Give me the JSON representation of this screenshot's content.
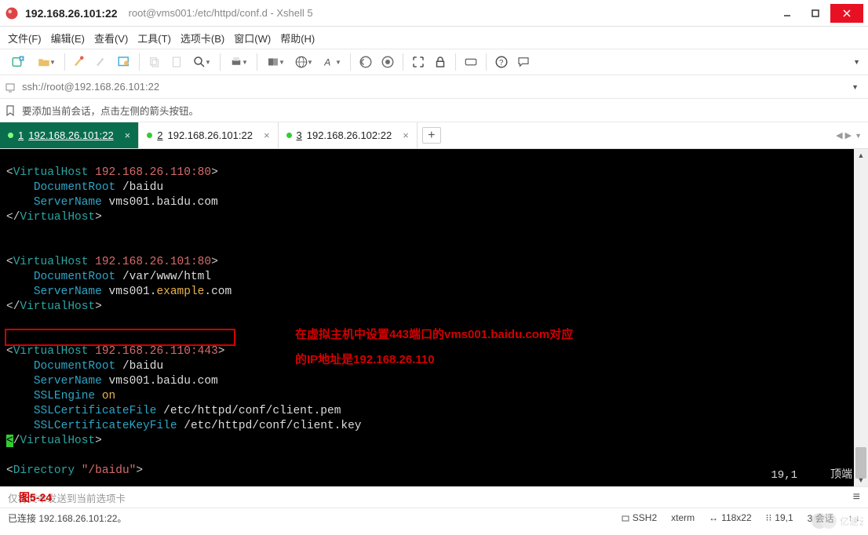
{
  "window": {
    "title_main": "192.168.26.101:22",
    "title_sub": "root@vms001:/etc/httpd/conf.d - Xshell 5"
  },
  "menu": {
    "file": "文件(F)",
    "edit": "编辑(E)",
    "view": "查看(V)",
    "tools": "工具(T)",
    "tabs": "选项卡(B)",
    "window": "窗口(W)",
    "help": "帮助(H)"
  },
  "address": {
    "url": "ssh://root@192.168.26.101:22"
  },
  "hint": {
    "text": "要添加当前会话，点击左侧的箭头按钮。"
  },
  "tabs": [
    {
      "num": "1",
      "ip": "192.168.26.101:22",
      "active": true
    },
    {
      "num": "2",
      "ip": "192.168.26.101:22",
      "active": false
    },
    {
      "num": "3",
      "ip": "192.168.26.102:22",
      "active": false
    }
  ],
  "add_tab": "+",
  "terminal": {
    "vh1_open": {
      "tag": "VirtualHost",
      "addr": "192.168.26.110:80"
    },
    "vh1_docroot_key": "DocumentRoot",
    "vh1_docroot_val": "/baidu",
    "vh1_servername_key": "ServerName",
    "vh1_servername_val": "vms001.baidu.com",
    "vh_close": "VirtualHost",
    "vh2_open": {
      "tag": "VirtualHost",
      "addr": "192.168.26.101:80"
    },
    "vh2_docroot_key": "DocumentRoot",
    "vh2_docroot_val": "/var/www/html",
    "vh2_servername_key": "ServerName",
    "vh2_servername_pre": "vms001.",
    "vh2_servername_ex": "example",
    "vh2_servername_post": ".com",
    "vh3_open": {
      "tag": "VirtualHost",
      "addr": "192.168.26.110:443"
    },
    "vh3_docroot_key": "DocumentRoot",
    "vh3_docroot_val": "/baidu",
    "vh3_servername_key": "ServerName",
    "vh3_servername_val": "vms001.baidu.com",
    "vh3_sslengine_key": "SSLEngine",
    "vh3_sslengine_val": "on",
    "vh3_cert_key": "SSLCertificateFile",
    "vh3_cert_val": "/etc/httpd/conf/client.pem",
    "vh3_certkey_key": "SSLCertificateKeyFile",
    "vh3_certkey_val": "/etc/httpd/conf/client.key",
    "dir_tag": "Directory",
    "dir_q": "\"/baidu\"",
    "annotation_l1": "在虚拟主机中设置443端口的vms001.baidu.com对应",
    "annotation_l2": "的IP地址是192.168.26.110",
    "cursor_pos": "19,1",
    "top_word": "顶端"
  },
  "inputbar": {
    "placeholder": "仅将文本发送到当前选项卡",
    "fig_label": "图5-24"
  },
  "status": {
    "connected": "已连接 192.168.26.101:22。",
    "ssh": "SSH2",
    "term": "xterm",
    "size": "118x22",
    "pos": "19,1",
    "sessions": "3 会话"
  }
}
